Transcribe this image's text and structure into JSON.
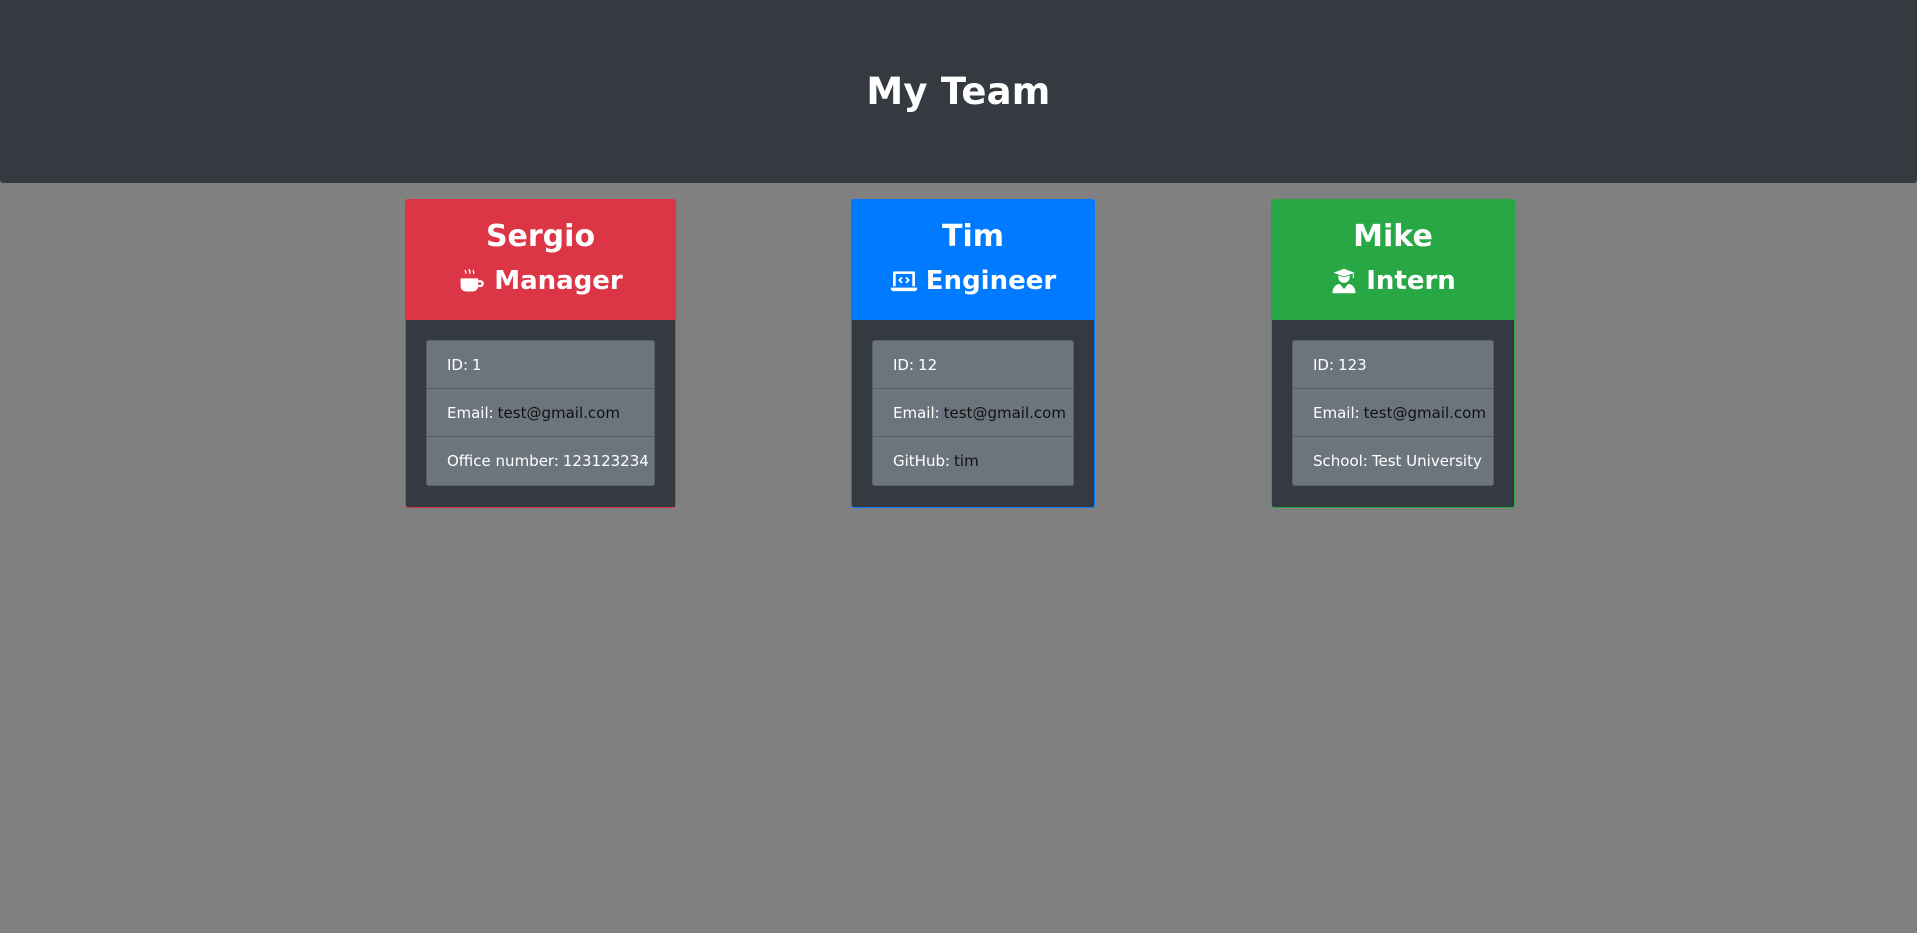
{
  "page": {
    "title": "My Team",
    "header_bg": "#343a40",
    "body_bg": "#808080"
  },
  "employees": [
    {
      "name": "Sergio",
      "role": "Manager",
      "icon": "mug-hot-icon",
      "color": "#dc3545",
      "details": [
        {
          "label": "ID:",
          "value": "1"
        },
        {
          "label": "Email:",
          "value": "test@gmail.com"
        },
        {
          "label": "Office number:",
          "value": "123123234"
        }
      ]
    },
    {
      "name": "Tim",
      "role": "Engineer",
      "icon": "laptop-code-icon",
      "color": "#007bff",
      "details": [
        {
          "label": "ID:",
          "value": "12"
        },
        {
          "label": "Email:",
          "value": "test@gmail.com"
        },
        {
          "label": "GitHub:",
          "value": "tim"
        }
      ]
    },
    {
      "name": "Mike",
      "role": "Intern",
      "icon": "user-graduate-icon",
      "color": "#28a745",
      "details": [
        {
          "label": "ID:",
          "value": "123"
        },
        {
          "label": "Email:",
          "value": "test@gmail.com"
        },
        {
          "label": "School:",
          "value": "Test University"
        }
      ]
    }
  ]
}
